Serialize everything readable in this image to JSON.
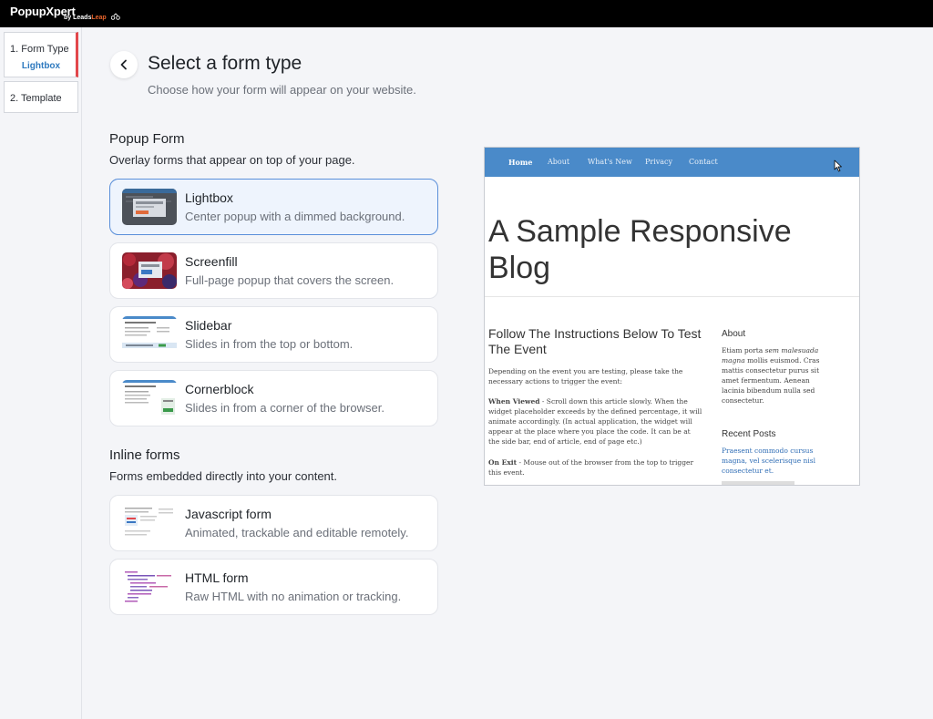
{
  "app": {
    "brand": "PopupXpert",
    "brand_sub_prefix": "by Leads",
    "brand_sub_suffix": "Leap"
  },
  "sidebar": {
    "steps": [
      {
        "label": "1. Form Type",
        "sub": "Lightbox"
      },
      {
        "label": "2. Template"
      }
    ]
  },
  "header": {
    "title": "Select a form type",
    "subtitle": "Choose how your form will appear on your website."
  },
  "popup_section": {
    "title": "Popup Form",
    "description": "Overlay forms that appear on top of your page.",
    "options": [
      {
        "title": "Lightbox",
        "description": "Center popup with a dimmed background."
      },
      {
        "title": "Screenfill",
        "description": "Full-page popup that covers the screen."
      },
      {
        "title": "Slidebar",
        "description": "Slides in from the top or bottom."
      },
      {
        "title": "Cornerblock",
        "description": "Slides in from a corner of the browser."
      }
    ]
  },
  "inline_section": {
    "title": "Inline forms",
    "description": "Forms embedded directly into your content.",
    "options": [
      {
        "title": "Javascript form",
        "description": "Animated, trackable and editable remotely."
      },
      {
        "title": "HTML form",
        "description": "Raw HTML with no animation or tracking."
      }
    ]
  },
  "preview": {
    "nav": [
      "Home",
      "About",
      "What's New",
      "Privacy",
      "Contact"
    ],
    "hero": "A Sample Responsive Blog",
    "article_title": "Follow The Instructions Below To Test The Event",
    "para1": "Depending on the event you are testing, please take the necessary actions to trigger the event:",
    "para2_label": "When Viewed",
    "para2": " - Scroll down this article slowly. When the widget placeholder exceeds by the defined percentage, it will animate accordingly. (In actual application, the widget will appear at the place where you place the code. It can be at the side bar, end of article, end of page etc.)",
    "para3_label": "On Exit",
    "para3": " - Mouse out of the browser from the top to trigger this event.",
    "about_title": "About",
    "about_text_1": "Etiam porta ",
    "about_text_em": "sem malesuada magna",
    "about_text_2": " mollis euismod. Cras mattis consectetur purus sit amet fermentum. Aenean lacinia bibendum nulla sed consectetur.",
    "recent_title": "Recent Posts",
    "recent_link": "Praesent commodo cursus magna, vel scelerisque nisl consectetur et."
  },
  "colors": {
    "accent": "#2f7abf",
    "active_step_marker": "#e2474b",
    "selected_card_bg": "#eef4fd",
    "selected_card_border": "#5a8fd9",
    "preview_nav": "#4a8ac9"
  }
}
